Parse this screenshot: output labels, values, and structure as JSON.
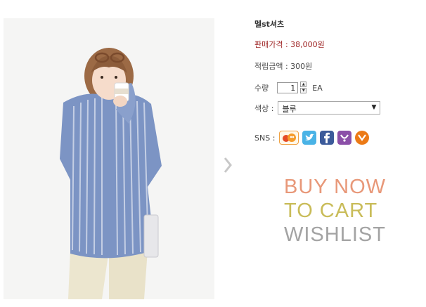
{
  "product": {
    "name": "멜st셔츠",
    "price_label": "판매가격 : 38,000원",
    "points_label": "적립금액 : 300원",
    "quantity_label": "수량",
    "quantity_value": "1",
    "quantity_unit": "EA",
    "color_label": "색상 :",
    "color_selected": "블루",
    "sns_label": "SNS :"
  },
  "sns_icons": [
    "me2day-icon",
    "twitter-icon",
    "facebook-icon",
    "yozm-icon",
    "cyworld-icon"
  ],
  "actions": {
    "buy_now": "BUY NOW",
    "to_cart": "TO CART",
    "wishlist": "WISHLIST"
  },
  "colors": {
    "price": "#9c1f1f",
    "buy_now": "#e89879",
    "to_cart": "#c9bc59",
    "wishlist": "#a3a3a3"
  }
}
